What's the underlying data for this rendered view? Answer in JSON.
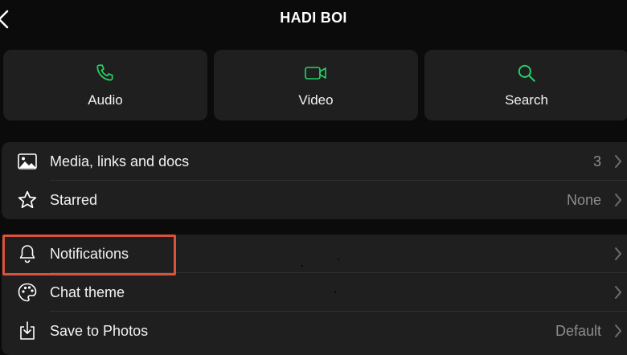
{
  "header": {
    "title": "HADI BOI"
  },
  "actions": [
    {
      "label": "Audio",
      "icon": "phone-icon"
    },
    {
      "label": "Video",
      "icon": "video-icon"
    },
    {
      "label": "Search",
      "icon": "search-icon"
    }
  ],
  "group1": {
    "media": {
      "label": "Media, links and docs",
      "value": "3",
      "icon": "image-icon"
    },
    "starred": {
      "label": "Starred",
      "value": "None",
      "icon": "star-icon"
    }
  },
  "group2": {
    "notifications": {
      "label": "Notifications",
      "icon": "bell-icon"
    },
    "chat_theme": {
      "label": "Chat theme",
      "icon": "palette-icon"
    },
    "save_to_photos": {
      "label": "Save to Photos",
      "value": "Default",
      "icon": "download-icon"
    }
  },
  "colors": {
    "accent": "#25d366",
    "highlight": "#d9523b",
    "card": "#1f1f1f",
    "background": "#0b0b0b"
  }
}
